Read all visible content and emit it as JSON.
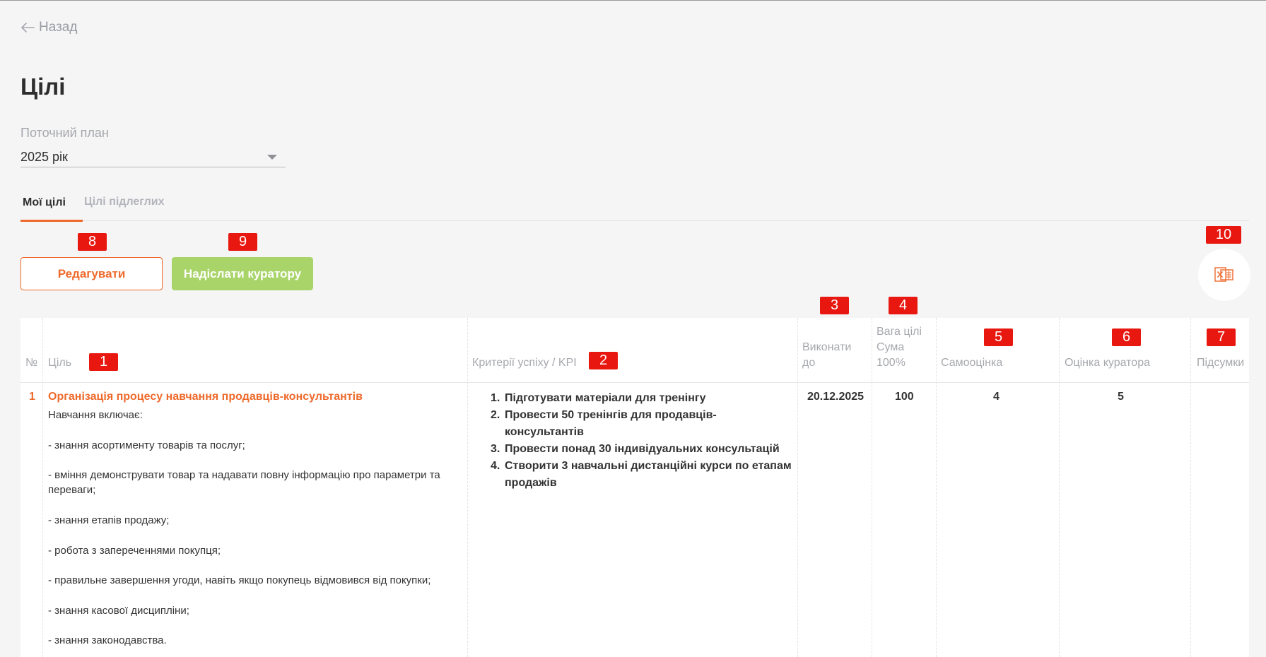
{
  "nav": {
    "back_label": "Назад"
  },
  "page": {
    "title": "Цілі"
  },
  "plan": {
    "label": "Поточний план",
    "value": "2025 рік"
  },
  "tabs": [
    {
      "label": "Мої цілі",
      "active": true
    },
    {
      "label": "Цілі підлеглих",
      "active": false
    }
  ],
  "actions": {
    "edit_label": "Редагувати",
    "send_label": "Надіслати куратору",
    "export_icon": "excel-icon"
  },
  "badges": [
    "1",
    "2",
    "3",
    "4",
    "5",
    "6",
    "7",
    "8",
    "9",
    "10"
  ],
  "table": {
    "headers": {
      "num": "№",
      "goal": "Ціль",
      "kpi": "Критерії успіху / KPI",
      "due": [
        "Виконати",
        "до"
      ],
      "weight": [
        "Вага цілі",
        "Сума",
        "100%"
      ],
      "self": "Самооцінка",
      "curator": "Оцінка куратора",
      "summary": "Підсумки"
    },
    "rows": [
      {
        "num": "1",
        "goal_title": "Організація процесу навчання продавців-консультантів",
        "goal_desc": [
          "Навчання включає:",
          "",
          "- знання асортименту товарів та послуг;",
          "",
          "- вміння демонструвати товар та надавати повну інформацію про параметри та переваги;",
          "",
          "- знання етапів продажу;",
          "",
          "- робота з запереченнями покупця;",
          "",
          "- правильне завершення угоди, навіть якщо покупець відмовився від покупки;",
          "",
          "- знання касової дисципліни;",
          "",
          "- знання законодавства."
        ],
        "kpi": [
          "Підготувати матеріали для тренінгу",
          "Провести 50 тренінгів для продавців-консультантів",
          "Провести понад 30 індивідуальних консультацій",
          "Створити 3 навчальні дистанційні курси по етапам продажів"
        ],
        "due": "20.12.2025",
        "weight": "100",
        "self": "4",
        "curator": "5",
        "summary": ""
      }
    ]
  },
  "colors": {
    "accent": "#ee6a2c",
    "send": "#a9d46a",
    "badge": "#e8170f"
  }
}
